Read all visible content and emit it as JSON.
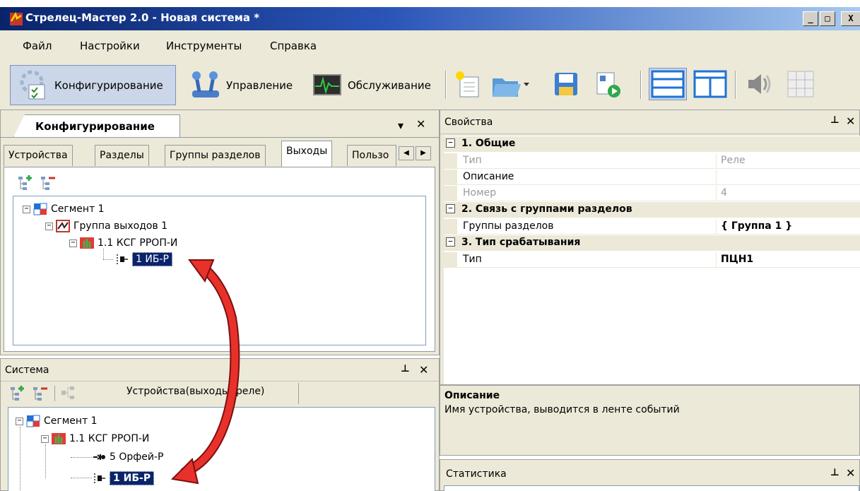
{
  "window": {
    "title": "Стрелец-Мастер 2.0 - Новая система *",
    "buttons": {
      "minimize": "_",
      "maximize": "□",
      "close": "X"
    }
  },
  "menu": [
    "Файл",
    "Настройки",
    "Инструменты",
    "Справка"
  ],
  "modes": [
    {
      "label": "Конфигурирование",
      "icon": "config-icon",
      "active": true
    },
    {
      "label": "Управление",
      "icon": "control-icon",
      "active": false
    },
    {
      "label": "Обслуживание",
      "icon": "service-icon",
      "active": false
    }
  ],
  "toolbar_icons": [
    "new-document-icon",
    "open-folder-icon",
    "save-icon",
    "run-icon",
    "layout-horizontal-icon",
    "layout-vertical-icon",
    "speaker-icon",
    "grid-icon"
  ],
  "config_panel": {
    "tab": "Конфигурирование",
    "dropdown": "▾",
    "close": "✕",
    "subtabs": [
      "Устройства",
      "Разделы",
      "Группы разделов",
      "Выходы",
      "Пользо"
    ],
    "active_subtab": "Выходы",
    "tree": [
      {
        "label": "Сегмент 1",
        "icon": "segment-icon"
      },
      {
        "label": "Группа выходов 1",
        "icon": "output-group-icon"
      },
      {
        "label": "1.1 КСГ РРОП-И",
        "icon": "device-icon"
      },
      {
        "label": "1 ИБ-Р",
        "icon": "relay-icon",
        "selected": true
      }
    ]
  },
  "system_panel": {
    "title": "Система",
    "pin": "ᵖ",
    "close": "✕",
    "filter_label": "Устройства(выходы, реле)",
    "tree": [
      {
        "label": "Сегмент 1",
        "icon": "segment-icon"
      },
      {
        "label": "1.1 КСГ РРОП-И",
        "icon": "device-icon"
      },
      {
        "label": "5 Орфей-Р",
        "icon": "siren-icon"
      },
      {
        "label": "1 ИБ-Р",
        "icon": "relay-icon",
        "selected": true
      }
    ]
  },
  "properties": {
    "title": "Свойства",
    "categories": [
      {
        "name": "1. Общие",
        "rows": [
          {
            "name": "Тип",
            "value": "Реле",
            "grey": true
          },
          {
            "name": "Описание",
            "value": "",
            "grey": false
          },
          {
            "name": "Номер",
            "value": "4",
            "grey": true
          }
        ]
      },
      {
        "name": "2. Связь с группами разделов",
        "rows": [
          {
            "name": "Группы разделов",
            "value": "{ Группа 1 }",
            "bold": true
          }
        ]
      },
      {
        "name": "3. Тип срабатывания",
        "rows": [
          {
            "name": "Тип",
            "value": "ПЦН1",
            "bold": true
          }
        ]
      }
    ]
  },
  "description": {
    "title": "Описание",
    "text": "Имя устройства, выводится в ленте событий"
  },
  "statistics": {
    "title": "Статистика"
  },
  "colors": {
    "titlebar": "#0a246a",
    "selection": "#0a246a",
    "arrow": "#e8312a",
    "panel": "#ece9d8"
  }
}
